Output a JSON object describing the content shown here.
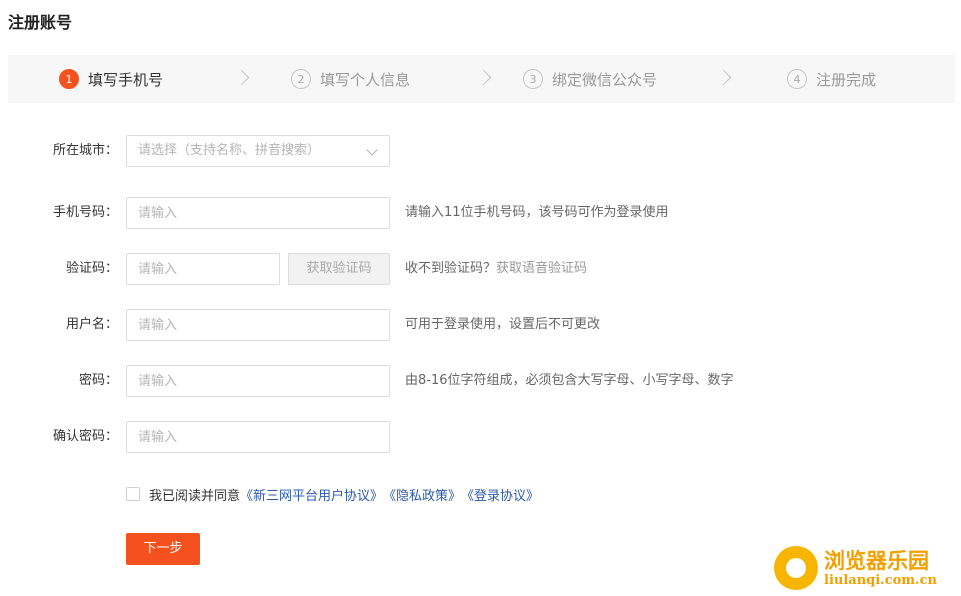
{
  "page_title": "注册账号",
  "steps": [
    {
      "num": "1",
      "label": "填写手机号"
    },
    {
      "num": "2",
      "label": "填写个人信息"
    },
    {
      "num": "3",
      "label": "绑定微信公众号"
    },
    {
      "num": "4",
      "label": "注册完成"
    }
  ],
  "form": {
    "city": {
      "label": "所在城市：",
      "placeholder": "请选择（支持名称、拼音搜索）"
    },
    "phone": {
      "label": "手机号码：",
      "placeholder": "请输入",
      "hint": "请输入11位手机号码，该号码可作为登录使用"
    },
    "code": {
      "label": "验证码：",
      "placeholder": "请输入",
      "button": "获取验证码",
      "hint": "收不到验证码？",
      "hint_link": "获取语音验证码"
    },
    "username": {
      "label": "用户名：",
      "placeholder": "请输入",
      "hint": "可用于登录使用，设置后不可更改"
    },
    "password": {
      "label": "密码：",
      "placeholder": "请输入",
      "hint": "由8-16位字符组成，必须包含大写字母、小写字母、数字"
    },
    "confirm": {
      "label": "确认密码：",
      "placeholder": "请输入"
    }
  },
  "agreement": {
    "text": "我已阅读并同意",
    "links": [
      "《新三网平台用户协议》",
      "《隐私政策》",
      "《登录协议》"
    ]
  },
  "next_button": "下一步",
  "watermark": {
    "cn": "浏览器乐园",
    "en": "liulanqi.com.cn"
  },
  "colors": {
    "accent": "#f4511e",
    "link": "#2b5aa8",
    "watermark": "#f2a000"
  }
}
